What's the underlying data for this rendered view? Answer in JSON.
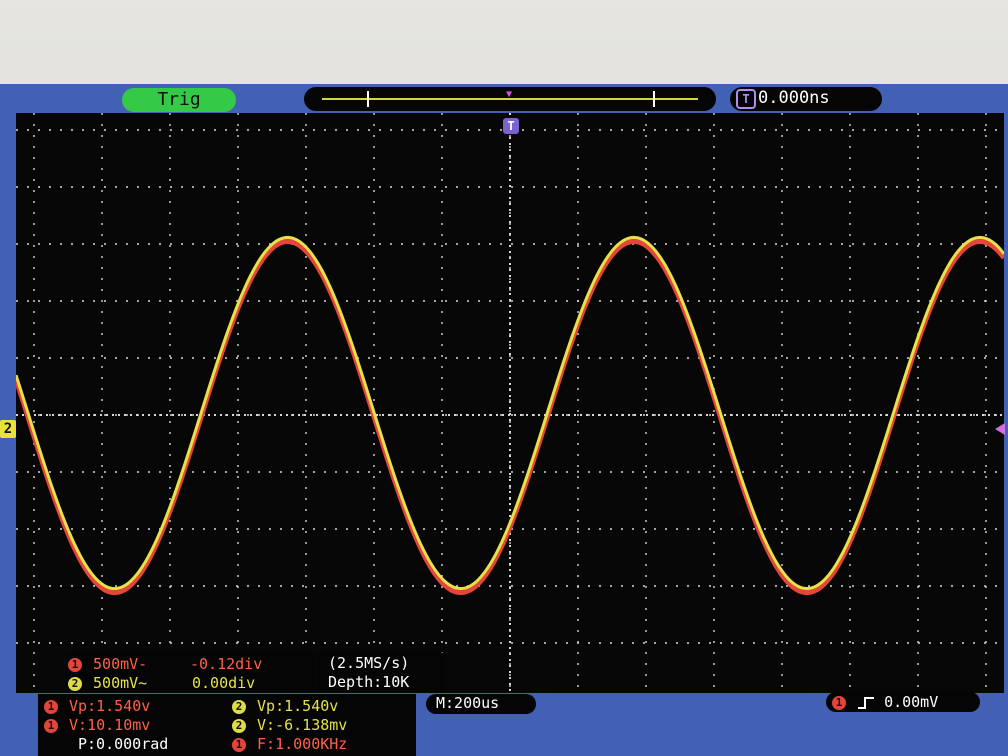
{
  "top_bar": {
    "trigger_status": "Trig",
    "trigger_position": "0.000ns",
    "trigger_icon": "T"
  },
  "markers": {
    "channel2": "2",
    "trigger": "T"
  },
  "channels": [
    {
      "num": "1",
      "scale": "500mV-",
      "offset": "-0.12div",
      "color": "#ff6048"
    },
    {
      "num": "2",
      "scale": "500mV~",
      "offset": "0.00div",
      "color": "#e6e24a"
    }
  ],
  "acquisition": {
    "sample_rate": "(2.5MS/s)",
    "depth": "Depth:10K"
  },
  "timebase": "M:200us",
  "trigger_info": {
    "channel": "1",
    "level": "0.00mV",
    "slope_icon": "rising-edge-icon"
  },
  "measurements": {
    "ch1_vp": "Vp:1.540v",
    "ch2_vp": "Vp:1.540v",
    "ch1_v": "V:10.10mv",
    "ch2_v": "V:-6.138mv",
    "phase": "P:0.000rad",
    "freq": "F:1.000KHz"
  },
  "colors": {
    "screen": "#070707",
    "frame": "#4261b4",
    "ch1": "#e6453a",
    "ch2": "#e6e24a",
    "grid": "#d8d8d8"
  },
  "chart_data": {
    "type": "line",
    "x_divisions": 14,
    "y_divisions": 10,
    "series": [
      {
        "name": "1",
        "frequency": "1.000KHz",
        "peak_volts": 1.54
      },
      {
        "name": "2",
        "frequency": "1.000KHz",
        "peak_volts": 1.54
      }
    ]
  }
}
